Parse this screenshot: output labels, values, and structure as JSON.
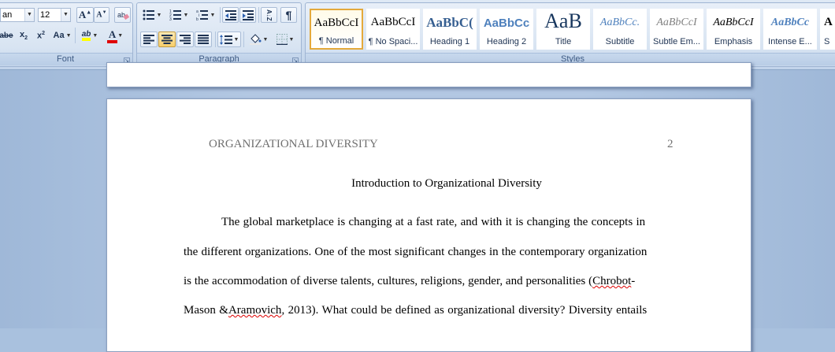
{
  "font_group": {
    "label": "Font",
    "font_name": "an",
    "font_size": "12",
    "grow_font": "A",
    "shrink_font": "A",
    "strikethrough": "abe",
    "subscript": "x",
    "superscript": "x",
    "change_case": "Aa",
    "highlight": "ab",
    "font_color": "A"
  },
  "paragraph_group": {
    "label": "Paragraph",
    "sort": "A↓Z",
    "show_marks": "¶"
  },
  "styles_group": {
    "label": "Styles",
    "items": [
      {
        "preview": "AaBbCcI",
        "name": "¶ Normal"
      },
      {
        "preview": "AaBbCcI",
        "name": "¶ No Spaci..."
      },
      {
        "preview": "AaBbC(",
        "name": "Heading 1"
      },
      {
        "preview": "AaBbCc",
        "name": "Heading 2"
      },
      {
        "preview": "AaB",
        "name": "Title"
      },
      {
        "preview": "AaBbCc.",
        "name": "Subtitle"
      },
      {
        "preview": "AaBbCcI",
        "name": "Subtle Em..."
      },
      {
        "preview": "AaBbCcI",
        "name": "Emphasis"
      },
      {
        "preview": "AaBbCc",
        "name": "Intense E..."
      },
      {
        "preview": "A",
        "name": "S"
      }
    ]
  },
  "document": {
    "running_head": "ORGANIZATIONAL DIVERSITY",
    "page_number": "2",
    "title": "Introduction to Organizational Diversity",
    "line1": "The global marketplace is changing at a fast rate, and with it is changing the concepts in",
    "line2": "the different organizations. One of the most significant changes in the contemporary organization",
    "line3_a": "is the accommodation of diverse talents, cultures, religions, gender, and personalities (",
    "line3_b": "Chrobot",
    "line3_c": "-",
    "line4_a": "Mason &",
    "line4_b": "Aramovich",
    "line4_c": ", 2013). What could be defined as organizational diversity? Diversity entails"
  },
  "colors": {
    "highlight_bar": "#ffff00",
    "font_color_bar": "#e00000",
    "selected_style_border": "#e4a93b"
  }
}
